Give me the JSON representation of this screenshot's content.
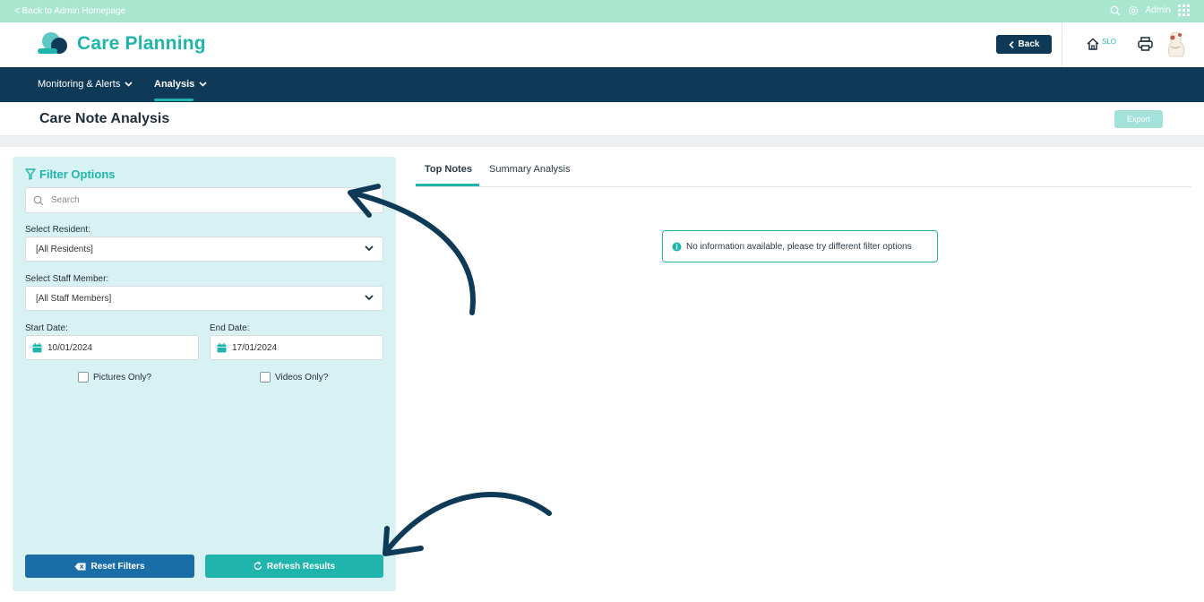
{
  "topbar": {
    "back_link": "< Back to Admin Homepage",
    "admin_label": "Admin"
  },
  "header": {
    "brand": "Care Planning",
    "back_button": "Back",
    "home_badge": "SLO"
  },
  "nav": {
    "items": [
      {
        "label": "Monitoring & Alerts"
      },
      {
        "label": "Analysis"
      }
    ]
  },
  "page": {
    "title": "Care Note Analysis",
    "export_button": "Export"
  },
  "filter": {
    "title": "Filter Options",
    "search_placeholder": "Search",
    "resident_label": "Select Resident:",
    "resident_value": "[All Residents]",
    "staff_label": "Select Staff Member:",
    "staff_value": "[All Staff Members]",
    "start_label": "Start Date:",
    "start_value": "10/01/2024",
    "end_label": "End Date:",
    "end_value": "17/01/2024",
    "pictures_label": "Pictures Only?",
    "videos_label": "Videos Only?",
    "reset_button": "Reset Filters",
    "refresh_button": "Refresh Results"
  },
  "tabs": [
    {
      "label": "Top Notes"
    },
    {
      "label": "Summary Analysis"
    }
  ],
  "notice": {
    "text": "No information available, please try different filter options"
  },
  "colors": {
    "teal": "#1fb5ac",
    "navy": "#0f3a57",
    "topbar": "#a8e6cf",
    "panel": "#d8f1f2",
    "reset": "#1a6ea8"
  }
}
